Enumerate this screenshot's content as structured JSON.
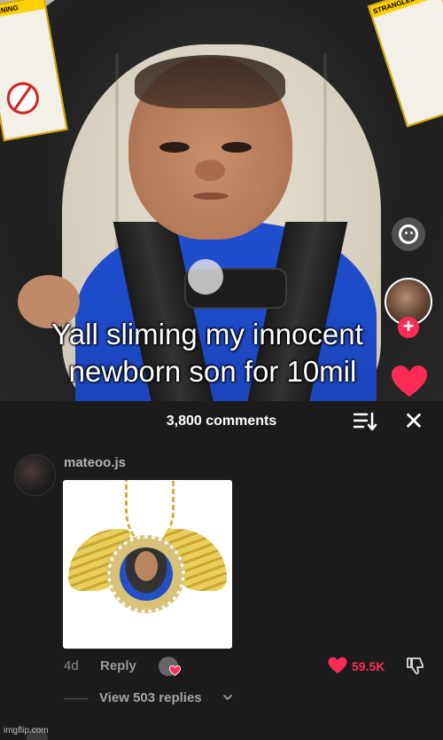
{
  "video": {
    "caption_line1": "Yall sliming my innocent",
    "caption_line2": "newborn son for 10mil",
    "warning_left": "WARNING",
    "warning_right": "STRANGLED"
  },
  "comments": {
    "title": "3,800 comments",
    "items": [
      {
        "username": "mateoo.js",
        "age": "4d",
        "reply_label": "Reply",
        "like_count": "59.5K",
        "replies_label": "View 503 replies"
      }
    ]
  },
  "watermark": "imgflip.com",
  "colors": {
    "accent": "#fe2c55",
    "sheet_bg": "#1b1b1b"
  },
  "icons": [
    "effect-icon",
    "plus-icon",
    "heart-icon",
    "sort-icon",
    "close-icon",
    "dislike-icon",
    "chevron-down-icon"
  ]
}
